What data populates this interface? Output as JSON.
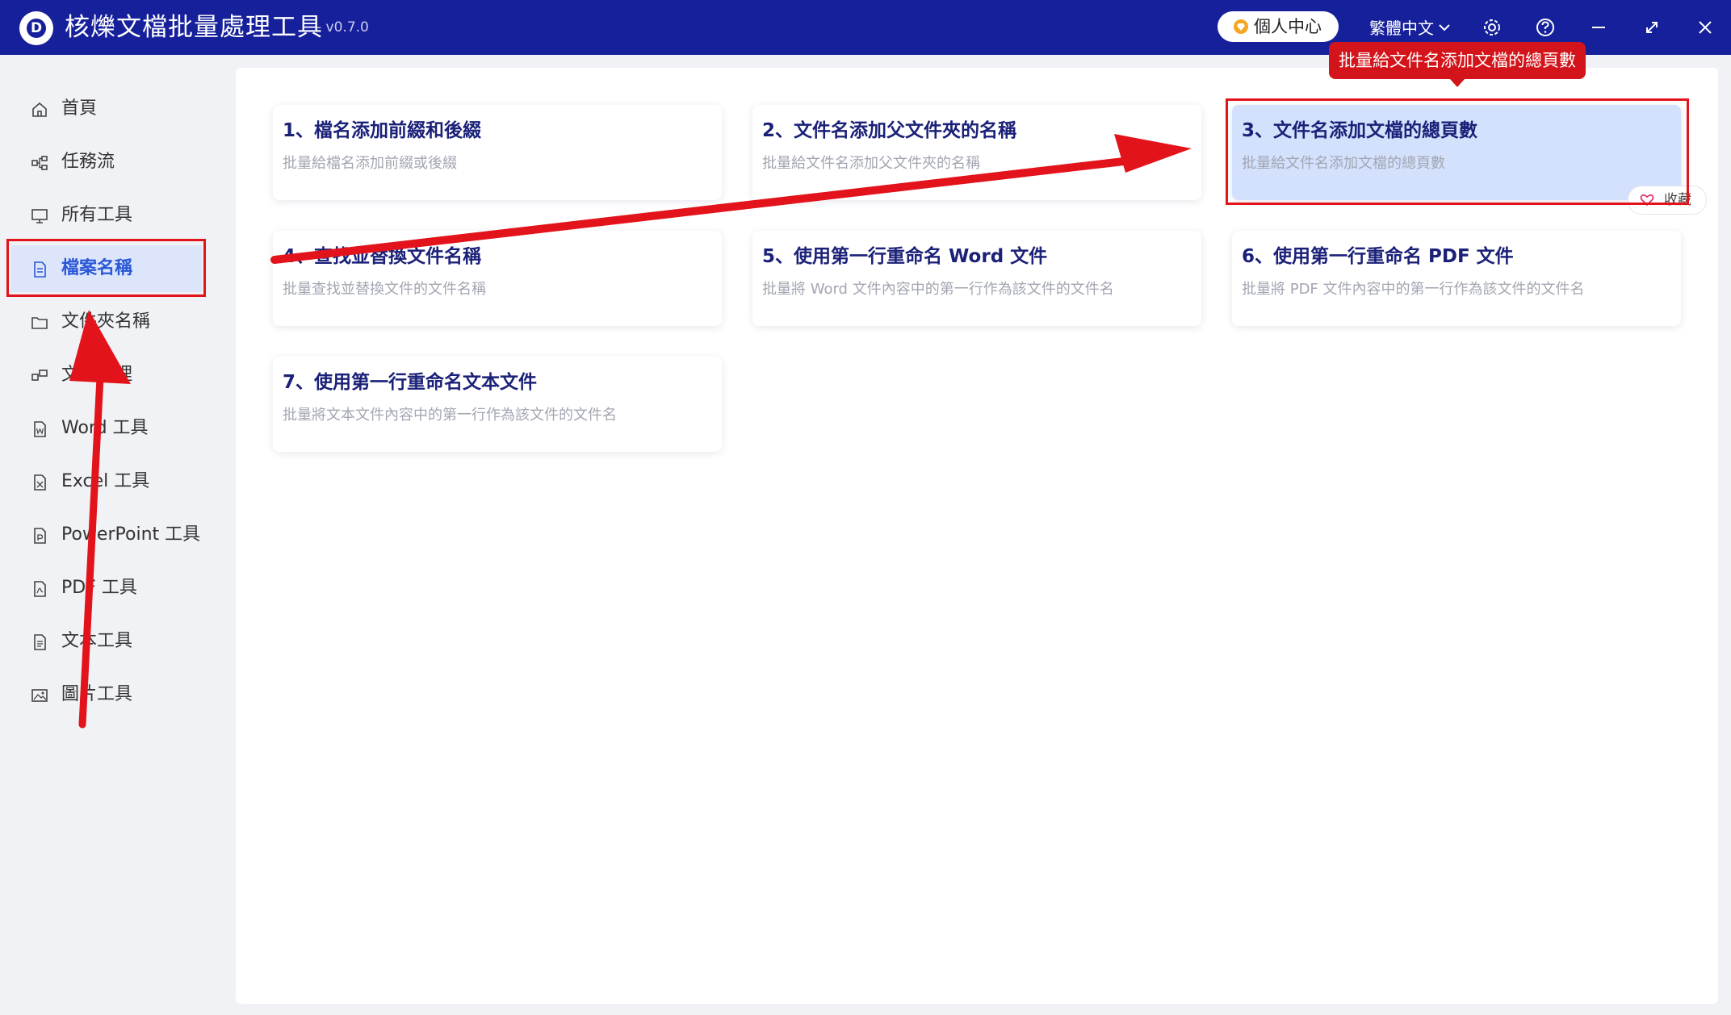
{
  "app": {
    "title": "核爍文檔批量處理工具",
    "version": "- v0.7.0",
    "logo_letter": "D",
    "user_center": "個人中心",
    "language": "繁體中文"
  },
  "sidebar": {
    "items": [
      {
        "label": "首頁",
        "icon": "home-icon"
      },
      {
        "label": "任務流",
        "icon": "workflow-icon"
      },
      {
        "label": "所有工具",
        "icon": "monitor-icon"
      },
      {
        "label": "檔案名稱",
        "icon": "file-name-icon"
      },
      {
        "label": "文件夾名稱",
        "icon": "folder-icon"
      },
      {
        "label": "文件整理",
        "icon": "organize-icon"
      },
      {
        "label": "Word 工具",
        "icon": "word-icon"
      },
      {
        "label": "Excel 工具",
        "icon": "excel-icon"
      },
      {
        "label": "PowerPoint 工具",
        "icon": "powerpoint-icon"
      },
      {
        "label": "PDF 工具",
        "icon": "pdf-icon"
      },
      {
        "label": "文本工具",
        "icon": "text-icon"
      },
      {
        "label": "圖片工具",
        "icon": "image-icon"
      }
    ],
    "active_index": 3
  },
  "cards": [
    {
      "title": "1、檔名添加前綴和後綴",
      "desc": "批量給檔名添加前綴或後綴"
    },
    {
      "title": "2、文件名添加父文件夾的名稱",
      "desc": "批量給文件名添加父文件夾的名稱"
    },
    {
      "title": "3、文件名添加文檔的總頁數",
      "desc": "批量給文件名添加文檔的總頁數"
    },
    {
      "title": "4、查找並替換文件名稱",
      "desc": "批量查找並替換文件的文件名稱"
    },
    {
      "title": "5、使用第一行重命名 Word 文件",
      "desc": "批量將 Word 文件內容中的第一行作為該文件的文件名"
    },
    {
      "title": "6、使用第一行重命名 PDF 文件",
      "desc": "批量將 PDF 文件內容中的第一行作為該文件的文件名"
    },
    {
      "title": "7、使用第一行重命名文本文件",
      "desc": "批量將文本文件內容中的第一行作為該文件的文件名"
    }
  ],
  "highlighted_card_index": 2,
  "favorite_label": "收藏",
  "tooltip": "批量給文件名添加文檔的總頁數",
  "colors": {
    "titlebar": "#16209a",
    "card_title": "#1b2178",
    "active_nav": "#2a58d6",
    "annotation_red": "#e3131b"
  }
}
